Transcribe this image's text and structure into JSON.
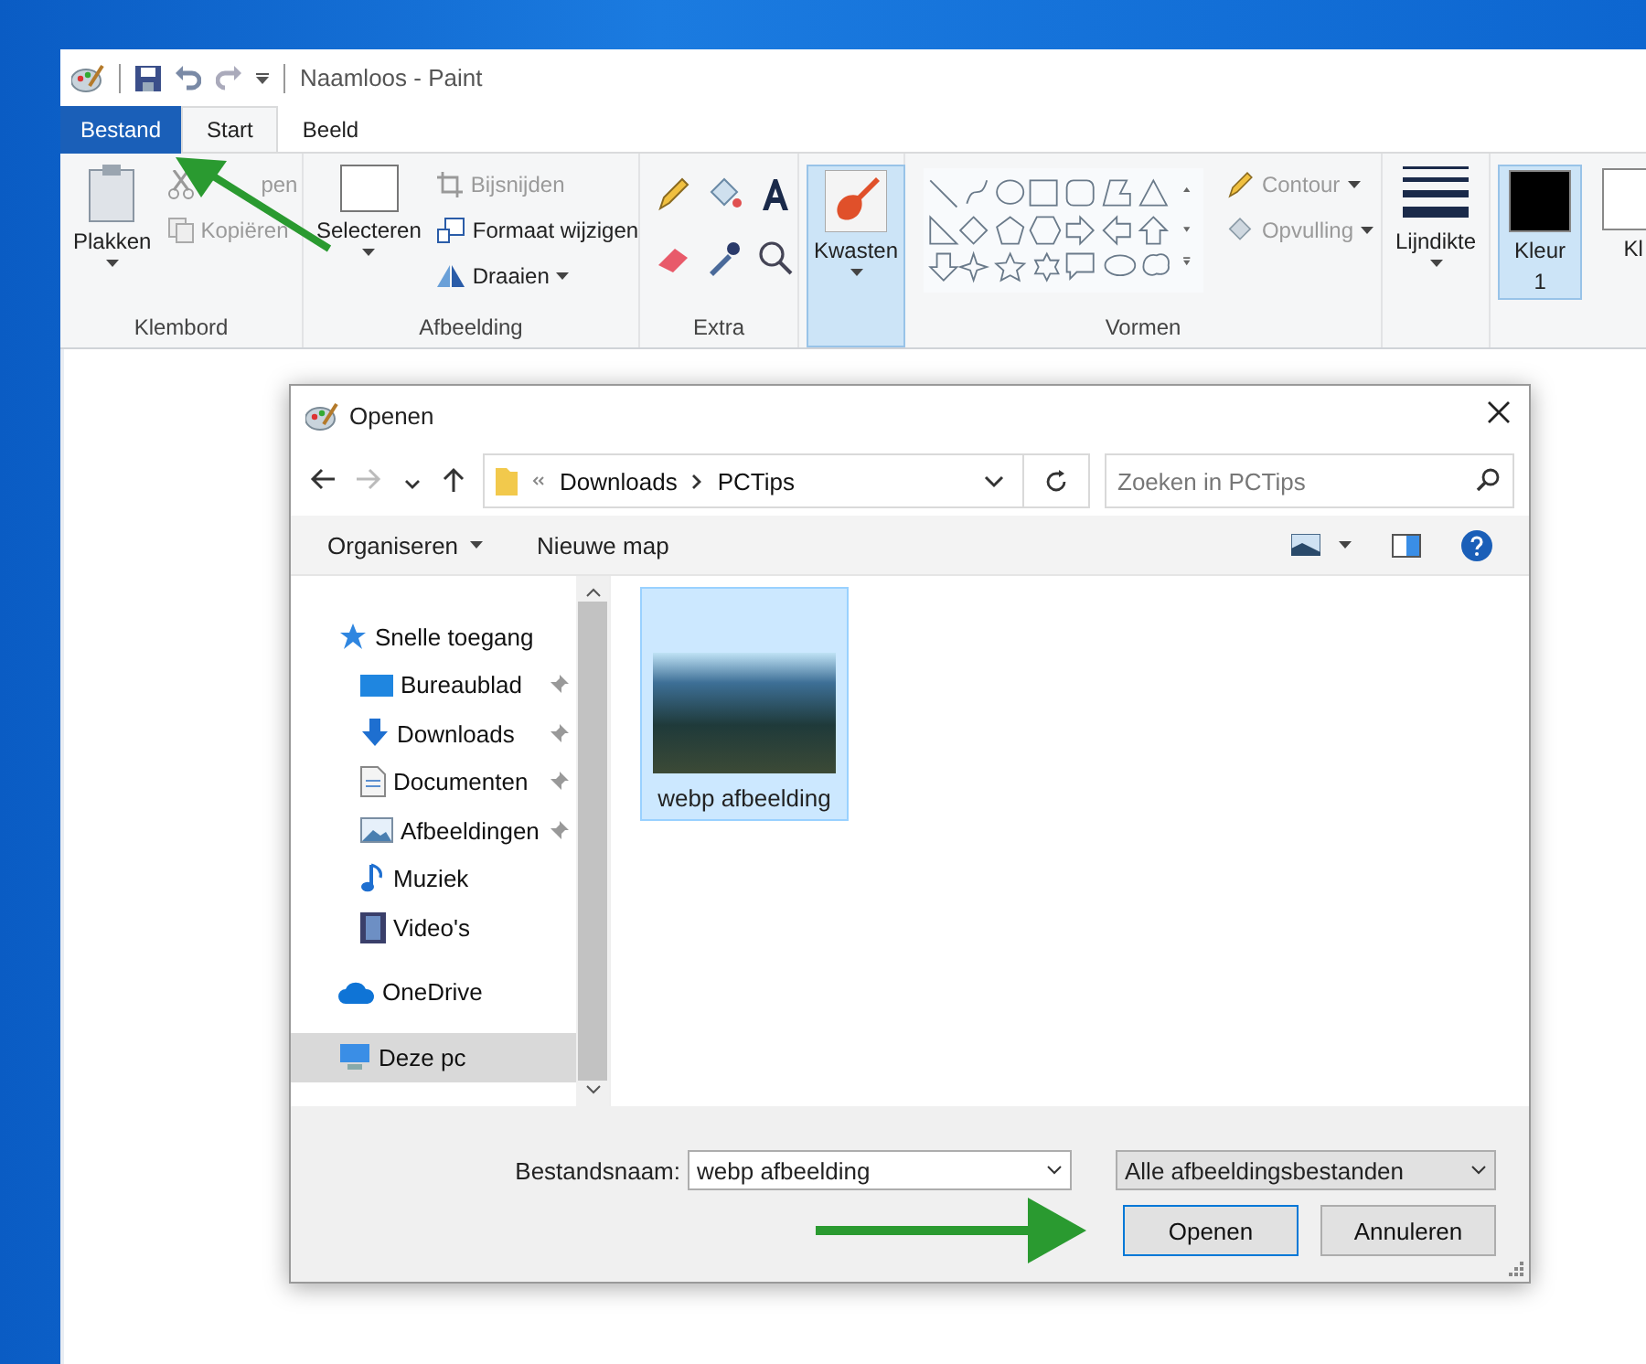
{
  "paint": {
    "title": "Naamloos - Paint",
    "tabs": [
      {
        "label": "Bestand",
        "kind": "file",
        "selected": false
      },
      {
        "label": "Start",
        "kind": "tab",
        "selected": true
      },
      {
        "label": "Beeld",
        "kind": "tab",
        "selected": false
      }
    ],
    "ribbon": {
      "klembord": {
        "label": "Klembord",
        "paste": "Plakken",
        "cut": {
          "label": "pen",
          "disabled": true
        },
        "copy": {
          "label": "Kopiëren",
          "disabled": true
        }
      },
      "afbeelding": {
        "label": "Afbeelding",
        "select": "Selecteren",
        "crop": {
          "label": "Bijsnijden",
          "disabled": true
        },
        "resize": {
          "label": "Formaat wijzigen",
          "disabled": false
        },
        "rotate": {
          "label": "Draaien",
          "disabled": false
        }
      },
      "extra": {
        "label": "Extra"
      },
      "brushes": {
        "label": "Kwasten",
        "selected": true
      },
      "vormen": {
        "label": "Vormen",
        "outline": "Contour",
        "fill": "Opvulling"
      },
      "size": {
        "label": "Lijndikte"
      },
      "colors": [
        {
          "label": "Kleur",
          "number": "1",
          "selected": true,
          "color": "#000000"
        },
        {
          "label": "Kl",
          "selected": false,
          "color": "#ffffff"
        }
      ]
    }
  },
  "dialog": {
    "title": "Openen",
    "path": [
      "Downloads",
      "PCTips"
    ],
    "search": {
      "placeholder": "Zoeken in PCTips"
    },
    "toolbar": {
      "organize": "Organiseren",
      "new_folder": "Nieuwe map"
    },
    "sidebar": [
      {
        "label": "Snelle toegang",
        "kind": "star",
        "selected": false,
        "children": [
          {
            "label": "Bureaublad",
            "kind": "desktop",
            "pinned": true,
            "selected": false
          },
          {
            "label": "Downloads",
            "kind": "download",
            "pinned": true,
            "selected": false
          },
          {
            "label": "Documenten",
            "kind": "document",
            "pinned": true,
            "selected": false
          },
          {
            "label": "Afbeeldingen",
            "kind": "pictures",
            "pinned": true,
            "selected": false
          },
          {
            "label": "Muziek",
            "kind": "music",
            "pinned": false,
            "selected": false
          },
          {
            "label": "Video's",
            "kind": "video",
            "pinned": false,
            "selected": false
          }
        ]
      },
      {
        "label": "OneDrive",
        "kind": "cloud",
        "selected": false
      },
      {
        "label": "Deze pc",
        "kind": "pc",
        "selected": true
      }
    ],
    "files": [
      {
        "name": "webp afbeelding",
        "selected": true
      }
    ],
    "filename_label": "Bestandsnaam:",
    "filename": "webp afbeelding",
    "filter": "Alle afbeeldingsbestanden",
    "buttons": [
      {
        "label": "Openen",
        "kind": "default"
      },
      {
        "label": "Annuleren",
        "kind": "normal"
      }
    ]
  }
}
